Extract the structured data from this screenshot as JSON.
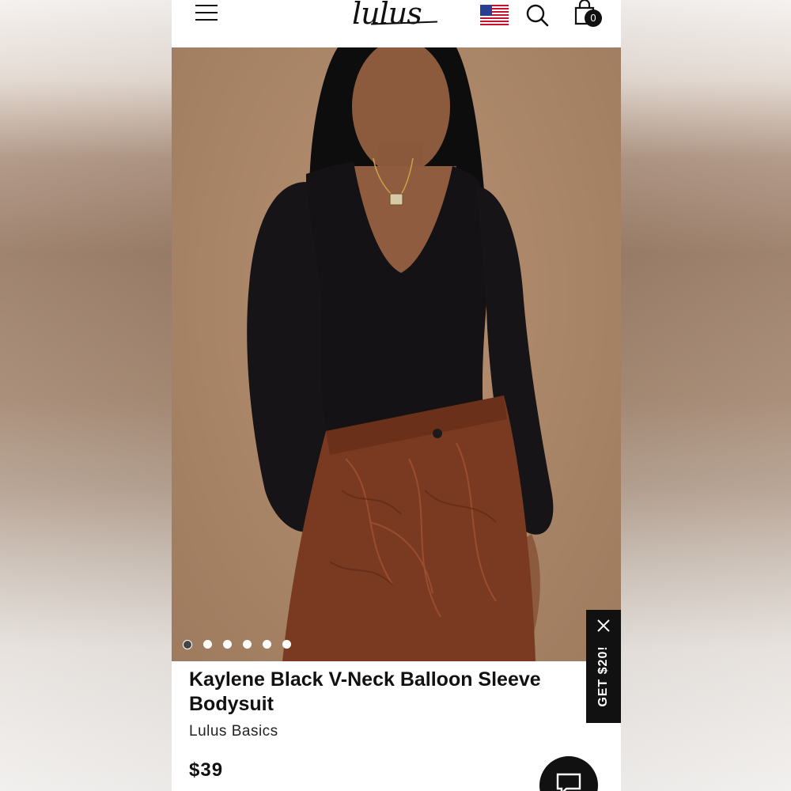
{
  "header": {
    "logo_text": "lulus",
    "menu_icon": "hamburger-menu-icon",
    "flag_icon": "us-flag-icon",
    "search_icon": "search-icon",
    "bag_icon": "shopping-bag-icon",
    "bag_count": "0"
  },
  "gallery": {
    "image_count": 6,
    "active_index": 0
  },
  "promo": {
    "label": "GET $20!",
    "close_icon": "close-icon"
  },
  "product": {
    "title": "Kaylene Black V-Neck Balloon Sleeve Bodysuit",
    "brand": "Lulus Basics",
    "price": "$39"
  },
  "chat": {
    "icon": "chat-icon"
  },
  "colors": {
    "accent": "#111111",
    "background": "#ffffff",
    "photo_backdrop": "#a88466"
  }
}
